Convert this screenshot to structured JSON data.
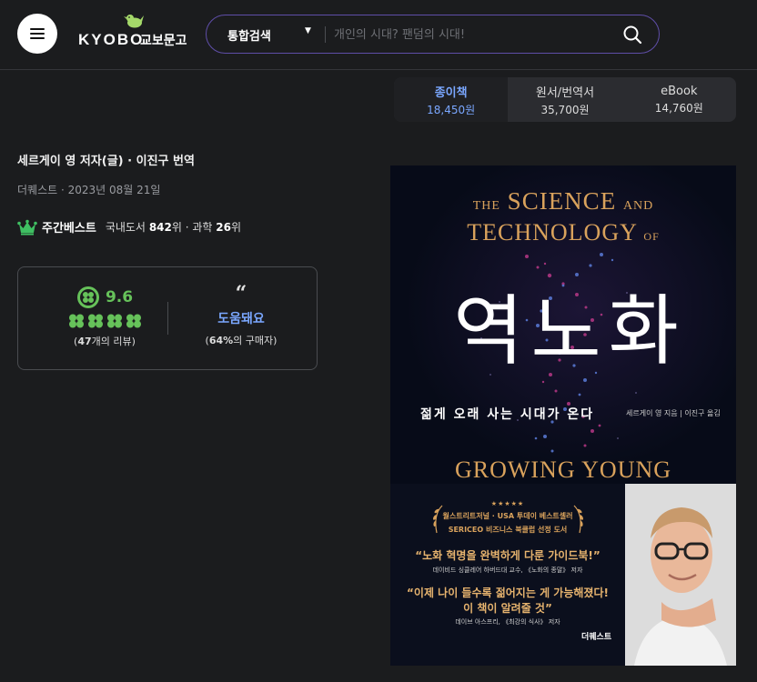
{
  "header": {
    "logo_en": "KYOBO",
    "logo_ko": "교보문고",
    "search": {
      "category": "통합검색",
      "placeholder": "개인의 시대? 팬덤의 시대!"
    }
  },
  "formats": [
    {
      "label": "종이책",
      "price": "18,450원",
      "active": true
    },
    {
      "label": "원서/번역서",
      "price": "35,700원",
      "active": false
    },
    {
      "label": "eBook",
      "price": "14,760원",
      "active": false
    }
  ],
  "book": {
    "authors": "세르게이 영 저자(글) · 이진구 번역",
    "publisher_date": "더퀘스트 · 2023년 08월 21일",
    "bestseller": {
      "title": "주간베스트",
      "domestic_label": "국내도서",
      "domestic_rank": "842",
      "rank_unit": "위",
      "separator": " · ",
      "science_label": "과학",
      "science_rank": "26",
      "science_unit": "위"
    }
  },
  "review": {
    "score": "9.6",
    "rating_clovers": 4,
    "review_count_open": "(",
    "review_count": "47",
    "review_count_suffix": "개의 리뷰)",
    "helpful_label": "도움돼요",
    "buyer_open": "(",
    "buyer_pct": "64%",
    "buyer_suffix": "의 구매자)"
  },
  "cover": {
    "line1_the": "THE",
    "line1_science": "SCIENCE",
    "line1_and": "AND",
    "line2_tech": "TECHNOLOGY",
    "line2_of": "OF",
    "title_ko": "역노화",
    "subtitle_ko": "젊게 오래 사는 시대가 온다",
    "author_line": "세르게이 영 지음 | 이진구 옮김",
    "title_en": "GROWING YOUNG",
    "stars": "★★★★★",
    "award1": "월스트리트저널 · USA 투데이 베스트셀러",
    "award2": "SERICEO 비즈니스 북클럽 선정 도서",
    "quote1": "“노화 혁명을 완벽하게 다룬 가이드북!”",
    "quote1_src": "데이비드 싱클레어 하버드대 교수, 《노화의 종말》 저자",
    "quote2_a": "“이제 나이 들수록 젊어지는 게 가능해졌다!",
    "quote2_b": "이 책이 알려줄 것”",
    "quote2_src": "데이브 아스프리, 《최강의 식사》 저자",
    "publisher_logo": "더퀘스트"
  },
  "colors": {
    "accent_blue": "#7aa7ff",
    "score_green": "#66c25a",
    "cover_gold": "#d9a25c",
    "search_border": "#5f4ea8"
  }
}
